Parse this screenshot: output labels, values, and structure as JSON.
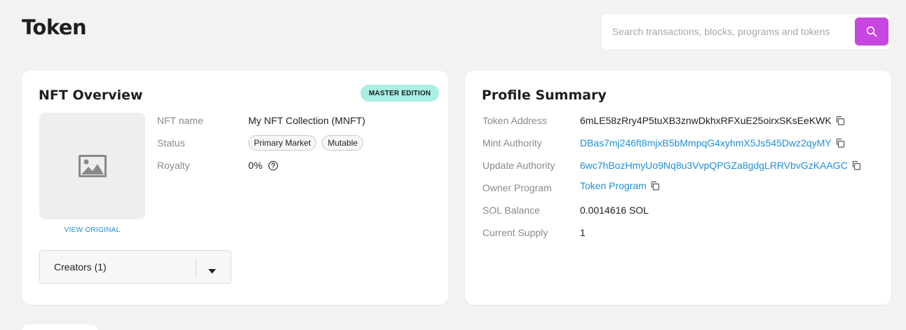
{
  "header": {
    "title": "Token",
    "search": {
      "placeholder": "Search transactions, blocks, programs and tokens",
      "value": "",
      "button_icon": "search-icon"
    }
  },
  "nft_overview": {
    "title": "NFT Overview",
    "badge": "MASTER EDITION",
    "image_icon": "image-icon",
    "view_original": "VIEW ORIGINAL",
    "rows": {
      "name": {
        "label": "NFT name",
        "value": "My NFT Collection (MNFT)"
      },
      "status": {
        "label": "Status",
        "pills": [
          "Primary Market",
          "Mutable"
        ]
      },
      "royalty": {
        "label": "Royalty",
        "value": "0%",
        "icon": "help-circle-icon"
      }
    },
    "creators": {
      "label": "Creators (1)",
      "icon": "caret-down-icon"
    }
  },
  "profile_summary": {
    "title": "Profile Summary",
    "rows": {
      "token_address": {
        "label": "Token Address",
        "value": "6mLE58zRry4P5tuXB3znwDkhxRFXuE25oirxSKsEeKWK"
      },
      "mint_authority": {
        "label": "Mint Authority",
        "value": "DBas7mj246ft8mjxB5bMmpqG4xyhmX5Js545Dwz2qyMY"
      },
      "update_authority": {
        "label": "Update Authority",
        "value": "6wc7hBozHmyUo9Nq8u3VvpQPGZa8gdgLRRVbvGzKAAGC"
      },
      "owner_program": {
        "label": "Owner Program",
        "value": "Token Program"
      },
      "sol_balance": {
        "label": "SOL Balance",
        "value": "0.0014616 SOL"
      },
      "current_supply": {
        "label": "Current Supply",
        "value": "1"
      }
    },
    "copy_icon": "copy-icon"
  },
  "colors": {
    "accent": "#c846e0",
    "link": "#1f8fd6",
    "badge_bg": "#a9efe3",
    "page_bg": "#f2f2f2"
  }
}
